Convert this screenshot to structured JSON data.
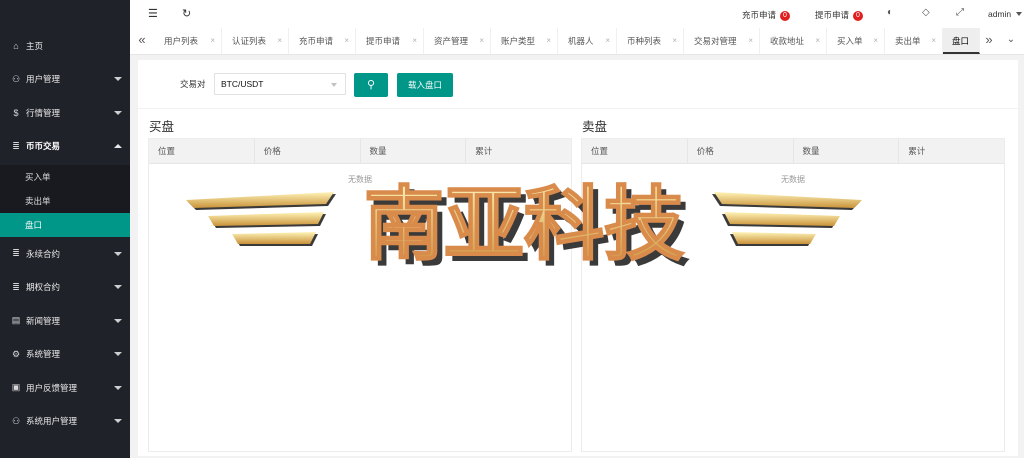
{
  "sidebar": {
    "items": [
      {
        "label": "主页",
        "icon": "home-icon",
        "glyph": "⌂"
      },
      {
        "label": "用户管理",
        "icon": "user-icon",
        "glyph": "⚇"
      },
      {
        "label": "行情管理",
        "icon": "dollar-icon",
        "glyph": "$"
      },
      {
        "label": "币币交易",
        "icon": "list-icon",
        "glyph": "≣"
      },
      {
        "label": "永续合约",
        "icon": "list-icon",
        "glyph": "≣"
      },
      {
        "label": "期权合约",
        "icon": "list-icon",
        "glyph": "≣"
      },
      {
        "label": "新闻管理",
        "icon": "news-icon",
        "glyph": "▤"
      },
      {
        "label": "系统管理",
        "icon": "gear-icon",
        "glyph": "⚙"
      },
      {
        "label": "用户反馈管理",
        "icon": "feedback-icon",
        "glyph": "▣"
      },
      {
        "label": "系统用户管理",
        "icon": "user-icon",
        "glyph": "⚇"
      }
    ],
    "submenu": [
      "买入单",
      "卖出单",
      "盘口"
    ]
  },
  "header": {
    "menu_glyph": "☰",
    "refresh_glyph": "↻",
    "deposit_label": "充币申请",
    "deposit_count": "0",
    "withdraw_label": "提币申请",
    "withdraw_count": "0",
    "theme_glyph": "◐",
    "tag_glyph": "◇",
    "fullscreen_glyph": "⤢",
    "user": "admin"
  },
  "tabs": {
    "prev_glyph": "«",
    "next_glyph": "»",
    "menu_glyph": "⌄",
    "close_glyph": "×",
    "items": [
      "用户列表",
      "认证列表",
      "充币申请",
      "提币申请",
      "资产管理",
      "账户类型",
      "机器人",
      "币种列表",
      "交易对管理",
      "收款地址",
      "买入单",
      "卖出单",
      "盘口"
    ]
  },
  "filter": {
    "label": "交易对",
    "value": "BTC/USDT",
    "search_glyph": "⚲",
    "load_label": "载入盘口"
  },
  "buy_panel": {
    "title": "买盘",
    "columns": [
      "位置",
      "价格",
      "数量",
      "累计"
    ],
    "empty": "无数据"
  },
  "sell_panel": {
    "title": "卖盘",
    "columns": [
      "位置",
      "价格",
      "数量",
      "累计"
    ],
    "empty": "无数据"
  },
  "watermark": {
    "text": "南亚科技",
    "colors": {
      "gold_light": "#fff4b8",
      "gold_dark": "#c9923a",
      "shadow": "#3a3a3a",
      "accent": "#d98b4c"
    }
  },
  "colors": {
    "accent": "#009688",
    "sidebar_bg": "#20222a",
    "badge": "#e02020"
  }
}
